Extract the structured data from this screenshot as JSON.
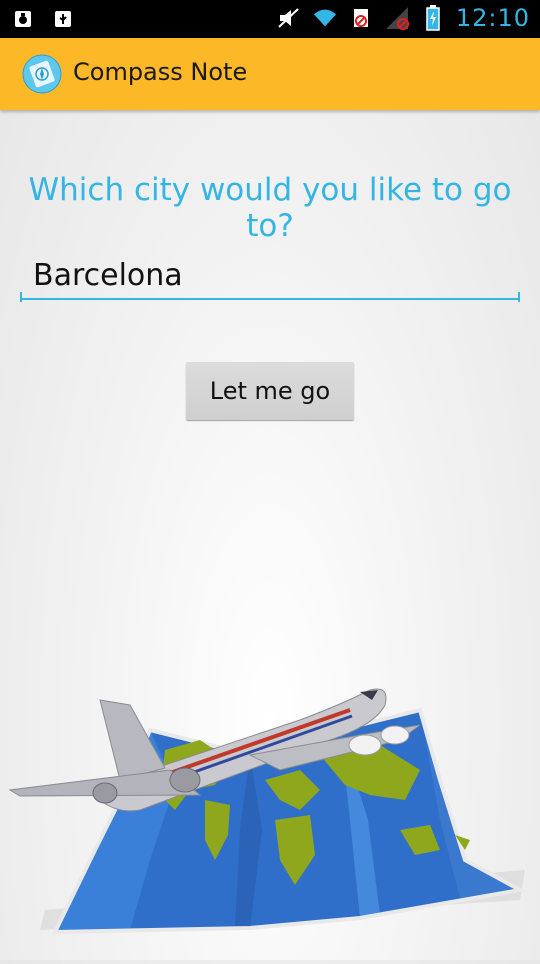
{
  "status_bar": {
    "time": "12:10",
    "icons": [
      "debug-icon",
      "usb-icon",
      "mute-icon",
      "wifi-icon",
      "no-sim-icon",
      "signal-icon",
      "battery-charging-icon"
    ]
  },
  "action_bar": {
    "title": "Compass Note",
    "icon": "compass-note-app-icon"
  },
  "main": {
    "question": "Which city would you like to go to?",
    "city_input_value": "Barcelona",
    "go_button_label": "Let me go",
    "illustration": "airplane-over-world-map"
  },
  "colors": {
    "accent": "#33b5e5",
    "action_bar": "#fcb827",
    "button": "#d6d6d6"
  }
}
